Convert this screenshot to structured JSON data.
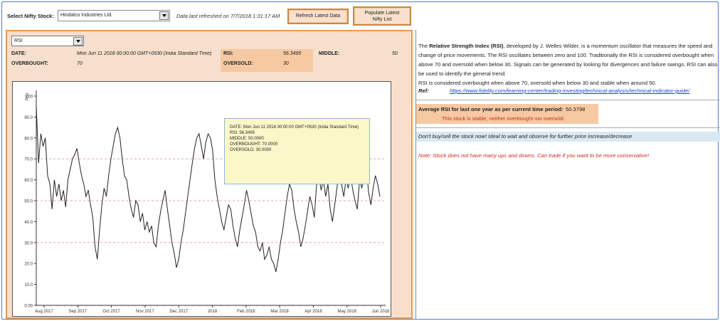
{
  "toolbar": {
    "stock_label": "Select Nifty Stock:",
    "stock_value": "Hindalco Industries Ltd.",
    "refresh_text": "Data last refreshed on 7/7/2018 1:31:17 AM",
    "refresh_button": "Refresh Latest Data",
    "populate_button_line1": "Populate Latest",
    "populate_button_line2": "Nifty List"
  },
  "indicator": {
    "selected": "RSI",
    "date_label": "DATE:",
    "date_value": "Mon Jun 11 2018 00:00:00 GMT+0530 (India Standard Time)",
    "rsi_label": "RSI:",
    "rsi_value": "56.3495",
    "middle_label": "MIDDLE:",
    "middle_value": "50",
    "overbought_label": "OVERBOUGHT:",
    "overbought_value": "70",
    "oversold_label": "OVERSOLD:",
    "oversold_value": "30"
  },
  "tooltip": {
    "line1": "DATE: Mon Jun 11 2018 00:00:00 GMT+0530 (India Standard Time)",
    "line2": "RSI: 56.3495",
    "line3": "MIDDLE: 50.0000",
    "line4": "OVERBOUGHT: 70.0000",
    "line5": "OVERSOLD: 30.0000"
  },
  "right_panel": {
    "desc_prefix": "The ",
    "desc_bold": "Relative Strength Index (RSI)",
    "desc_rest": ", developed by J. Welles Wilder, is a momentum oscillator that measures the speed and change of price movements. The RSI oscillates between zero and 100. Traditionally the RSI is considered overbought when above 70 and oversold when below 30. Signals can be generated by looking for divergences and failure swings. RSI can also be used to identify the general trend.",
    "desc_line2": "RSI is considered overbought when above 70, oversold when below 30 and stable when around 50.",
    "ref_label": "Ref:",
    "ref_link": "https://www.fidelity.com/learning-center/trading-investing/technical-analysis/technical-indicator-guide/",
    "avg_label": "Average RSI for last one year as per current time period:",
    "avg_value": "50.3798",
    "stable_text": "This stock is stable, neither overbought nor oversold",
    "advice": "Don't buy/sell the stock now! Ideal to wait and observe for further price increase/decrease",
    "note": "Note: Stock does not have many ups and downs. Can trade if you want to be more conservative!"
  },
  "chart_data": {
    "type": "line",
    "ylabel": "RSI",
    "ylim": [
      0,
      100
    ],
    "yticks": [
      "0.00",
      "10.0",
      "20.0",
      "30.0",
      "40.0",
      "50.0",
      "60.0",
      "70.0",
      "80.0",
      "90.0",
      "100"
    ],
    "xtick_labels": [
      "Aug 2017",
      "Sep 2017",
      "Oct 2017",
      "Nov 2017",
      "Dec 2017",
      "2018",
      "Feb 2018",
      "Mar 2018",
      "Apr 2018",
      "May 2018",
      "Jun 2018"
    ],
    "reference_lines": [
      70,
      50,
      30
    ],
    "reference_color": "#e8a0a0",
    "line_color": "#222222",
    "series": [
      {
        "values": [
          95,
          68,
          82,
          76,
          80,
          62,
          58,
          46,
          60,
          52,
          58,
          50,
          55,
          47,
          60,
          65,
          70,
          72,
          75,
          68,
          62,
          58,
          52,
          55,
          48,
          42,
          28,
          22,
          36,
          48,
          56,
          52,
          62,
          70,
          76,
          82,
          85,
          80,
          70,
          62,
          60,
          52,
          46,
          42,
          50,
          48,
          40,
          44,
          36,
          40,
          35,
          38,
          30,
          28,
          38,
          45,
          50,
          55,
          46,
          38,
          30,
          25,
          18,
          22,
          30,
          36,
          44,
          52,
          60,
          68,
          75,
          80,
          82,
          76,
          70,
          78,
          82,
          80,
          74,
          60,
          52,
          46,
          40,
          36,
          42,
          48,
          46,
          38,
          32,
          28,
          36,
          42,
          48,
          55,
          50,
          44,
          38,
          35,
          28,
          26,
          30,
          22,
          24,
          28,
          22,
          20,
          16,
          22,
          30,
          36,
          44,
          52,
          58,
          55,
          46,
          40,
          35,
          28,
          32,
          38,
          45,
          52,
          48,
          42,
          58,
          62,
          55,
          60,
          52,
          58,
          46,
          40,
          48,
          56,
          66,
          58,
          52,
          60,
          56,
          62,
          55,
          50,
          46,
          60,
          56,
          62,
          66,
          54,
          48,
          56,
          62,
          58,
          52
        ]
      }
    ]
  }
}
